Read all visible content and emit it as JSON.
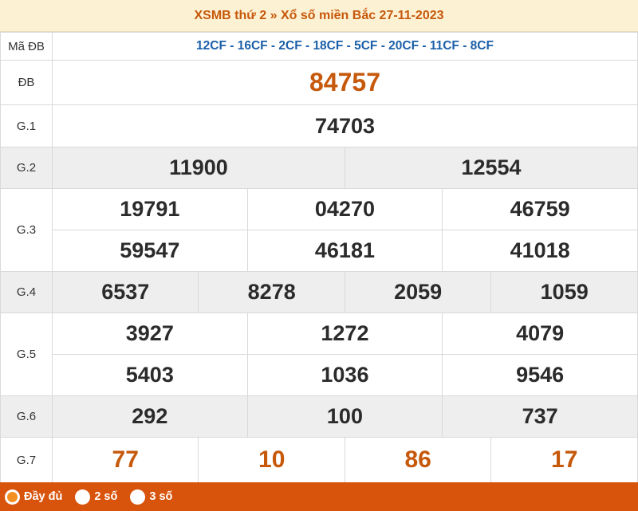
{
  "title": "XSMB thứ 2 » Xổ số miền Bắc 27-11-2023",
  "ma_db": {
    "label": "Mã ĐB",
    "value": "12CF - 16CF - 2CF - 18CF - 5CF - 20CF - 11CF - 8CF"
  },
  "prizes": {
    "db": {
      "label": "ĐB",
      "numbers": [
        "84757"
      ]
    },
    "g1": {
      "label": "G.1",
      "numbers": [
        "74703"
      ]
    },
    "g2": {
      "label": "G.2",
      "numbers": [
        "11900",
        "12554"
      ]
    },
    "g3": {
      "label": "G.3",
      "numbers": [
        "19791",
        "04270",
        "46759",
        "59547",
        "46181",
        "41018"
      ]
    },
    "g4": {
      "label": "G.4",
      "numbers": [
        "6537",
        "8278",
        "2059",
        "1059"
      ]
    },
    "g5": {
      "label": "G.5",
      "numbers": [
        "3927",
        "1272",
        "4079",
        "5403",
        "1036",
        "9546"
      ]
    },
    "g6": {
      "label": "G.6",
      "numbers": [
        "292",
        "100",
        "737"
      ]
    },
    "g7": {
      "label": "G.7",
      "numbers": [
        "77",
        "10",
        "86",
        "17"
      ]
    }
  },
  "footer": {
    "options": [
      {
        "label": "Đầy đủ",
        "selected": true
      },
      {
        "label": "2 số",
        "selected": false
      },
      {
        "label": "3 số",
        "selected": false
      }
    ]
  },
  "colors": {
    "accent": "#c6590b",
    "footer_bg": "#d8530c",
    "madb": "#1b5fa8",
    "header_bg": "#fdf1d4"
  }
}
